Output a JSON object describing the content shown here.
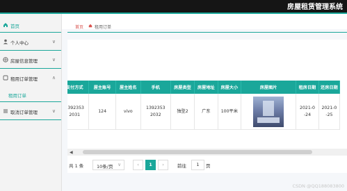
{
  "header": {
    "title": "房屋租赁管理系统"
  },
  "sidebar": {
    "items": [
      {
        "label": "首页",
        "icon": "home-icon"
      },
      {
        "label": "个人中心",
        "icon": "user-icon"
      },
      {
        "label": "房屋信息管理",
        "icon": "globe-icon"
      },
      {
        "label": "租用订单管理",
        "icon": "order-icon"
      },
      {
        "label": "取消订单管理",
        "icon": "list-icon"
      }
    ],
    "subitem": "租用订单"
  },
  "breadcrumb": {
    "home": "首页",
    "current": "租用订单"
  },
  "table": {
    "columns": [
      "支付方式",
      "屋主账号",
      "屋主姓名",
      "手机",
      "房屋类型",
      "房屋地址",
      "房屋大小",
      "房屋图片",
      "租房日期",
      "还房日期"
    ],
    "rows": [
      {
        "pay": "1392353\n2031",
        "account": "124",
        "name": "vivo",
        "phone": "1392353\n2032",
        "type": "独型2",
        "address": "广东",
        "size": "100平米",
        "image": "house-photo",
        "rent_date": "2021-0\n-24",
        "return_date": "2021-0\n-25"
      }
    ]
  },
  "pagination": {
    "total": "共 1 条",
    "page_size": "10条/页",
    "current_page": "1",
    "goto_label": "前往",
    "goto_value": "1",
    "page_unit": "页"
  },
  "watermark": "CSDN @QQ188083800",
  "colors": {
    "accent": "#1aa79a",
    "topbar": "#151515"
  }
}
